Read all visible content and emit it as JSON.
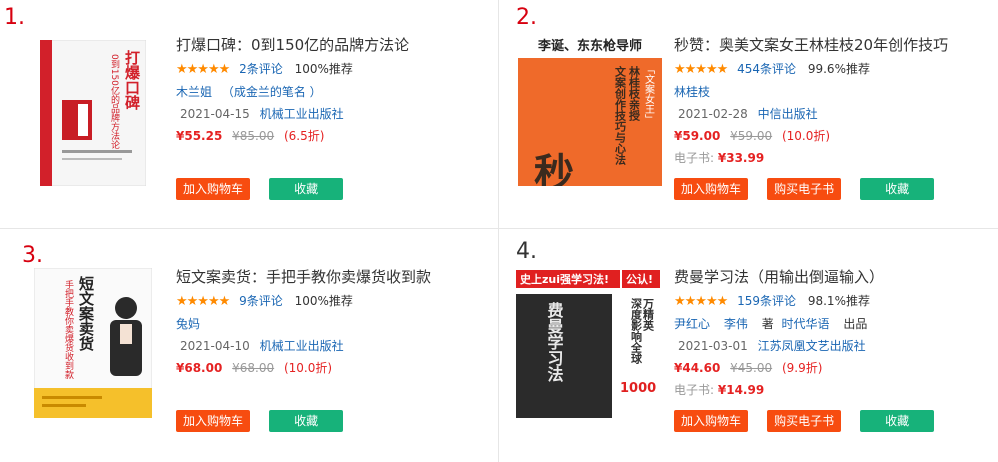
{
  "books": [
    {
      "rank": "1.",
      "title": "打爆口碑：0到150亿的品牌方法论",
      "stars": "★★★★★",
      "reviews": "2条评论",
      "recommend": "100%推荐",
      "author": "木兰姐",
      "author_note": "（成金兰的笔名 ）",
      "date": "2021-04-15",
      "publisher": "机械工业出版社",
      "price": "¥55.25",
      "original_price": "¥85.00",
      "discount": "(6.5折)",
      "cover_text": "打爆口碑",
      "cover_sub": "0到150亿的品牌方法论",
      "cart_label": "加入购物车",
      "fav_label": "收藏"
    },
    {
      "rank": "2.",
      "title": "秒赞：奥美文案女王林桂枝20年创作技巧",
      "stars": "★★★★★",
      "reviews": "454条评论",
      "recommend": "99.6%推荐",
      "author": "林桂枝",
      "date": "2021-02-28",
      "publisher": "中信出版社",
      "price": "¥59.00",
      "original_price": "¥59.00",
      "discount": "(10.0折)",
      "ebook_label": "电子书:",
      "ebook_price": "¥33.99",
      "cover_banner": "李诞、东东枪导师",
      "cover_big": "秒赞",
      "cover_side": "林桂枝亲授",
      "cover_side2": "文案创作技巧与心法",
      "cover_tag": "「文案女王」",
      "cart_label": "加入购物车",
      "ebook_btn_label": "购买电子书",
      "fav_label": "收藏"
    },
    {
      "rank": "3.",
      "title": "短文案卖货：手把手教你卖爆货收到款",
      "stars": "★★★★★",
      "reviews": "9条评论",
      "recommend": "100%推荐",
      "author": "兔妈",
      "date": "2021-04-10",
      "publisher": "机械工业出版社",
      "price": "¥68.00",
      "original_price": "¥68.00",
      "discount": "(10.0折)",
      "cover_big": "短文案卖货",
      "cover_sub": "手把手教你卖爆货收到款",
      "cart_label": "加入购物车",
      "fav_label": "收藏"
    },
    {
      "rank": "4.",
      "title": "费曼学习法（用输出倒逼输入）",
      "stars": "★★★★★",
      "reviews": "159条评论",
      "recommend": "98.1%推荐",
      "author": "尹红心",
      "author2": "李伟",
      "author_role": "著",
      "publisher_brand": "时代华语",
      "publisher_role": "出品",
      "date": "2021-03-01",
      "publisher": "江苏凤凰文艺出版社",
      "price": "¥44.60",
      "original_price": "¥45.00",
      "discount": "(9.9折)",
      "ebook_label": "电子书:",
      "ebook_price": "¥14.99",
      "cover_banner": "史上zui强学习法!",
      "cover_banner2": "公认!",
      "cover_big": "费曼学习法",
      "cover_side": "深度影响全球",
      "cover_num": "1000",
      "cover_side2": "万精英",
      "cart_label": "加入购物车",
      "ebook_btn_label": "购买电子书",
      "fav_label": "收藏"
    }
  ],
  "colors": {
    "rank_red": "#d7000f",
    "price_red": "#e52222",
    "link_blue": "#1a66b3",
    "btn_orange": "#f74c10",
    "btn_green": "#17b27a",
    "star_orange": "#ff8a00"
  }
}
